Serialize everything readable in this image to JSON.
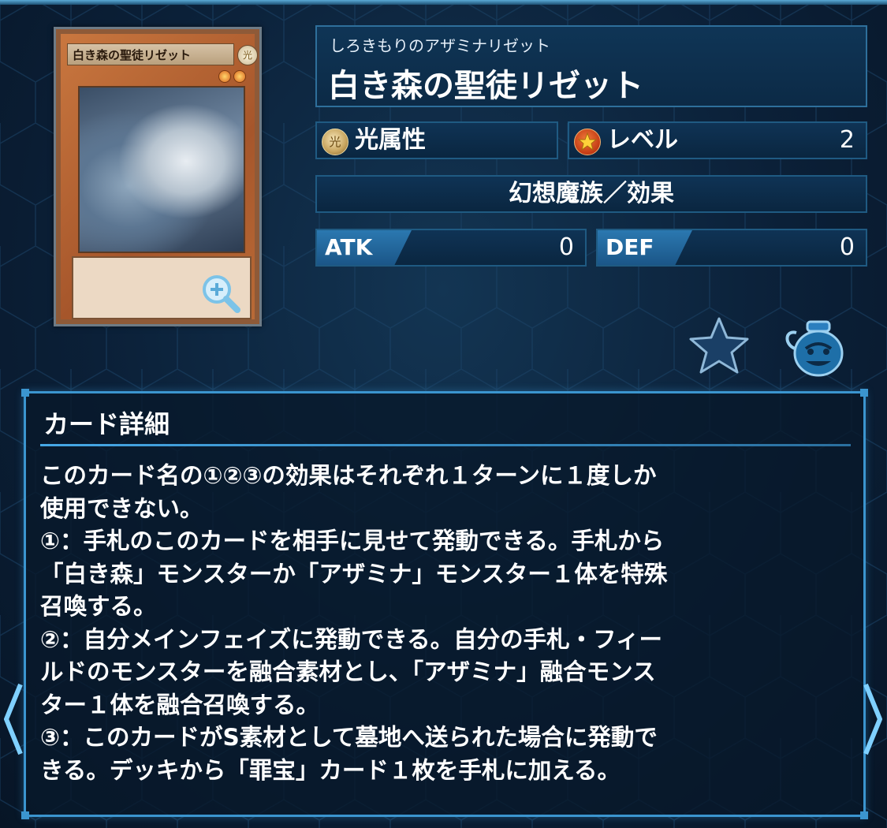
{
  "card": {
    "image_name_text": "白き森の聖徒リゼット",
    "image_attribute_glyph": "光",
    "reading": "しろきもりのアザミナリゼット",
    "name": "白き森の聖徒リゼット"
  },
  "stats": {
    "attribute_label": "光属性",
    "attribute_icon_glyph": "光",
    "level_label": "レベル",
    "level_value": "2",
    "type_line": "幻想魔族／効果",
    "atk_label": "ATK",
    "atk_value": "0",
    "def_label": "DEF",
    "def_value": "0"
  },
  "icons": {
    "zoom": "zoom-in-icon",
    "favorite": "star-icon",
    "pot": "pot-of-greed-icon",
    "prev": "chevron-left-icon",
    "next": "chevron-right-icon"
  },
  "detail": {
    "title": "カード詳細",
    "text": "このカード名の①②③の効果はそれぞれ１ターンに１度しか\n使用できない。\n①：手札のこのカードを相手に見せて発動できる。手札から\n「白き森」モンスターか「アザミナ」モンスター１体を特殊\n召喚する。\n②：自分メインフェイズに発動できる。自分の手札・フィー\nルドのモンスターを融合素材とし、「アザミナ」融合モンス\nター１体を融合召喚する。\n③：このカードがS素材として墓地へ送られた場合に発動で\nきる。デッキから「罪宝」カード１枚を手札に加える。"
  },
  "colors": {
    "accent": "#3b95cf",
    "panel_bg": "#0c2a46",
    "tag_blue": "#2b78b0"
  }
}
